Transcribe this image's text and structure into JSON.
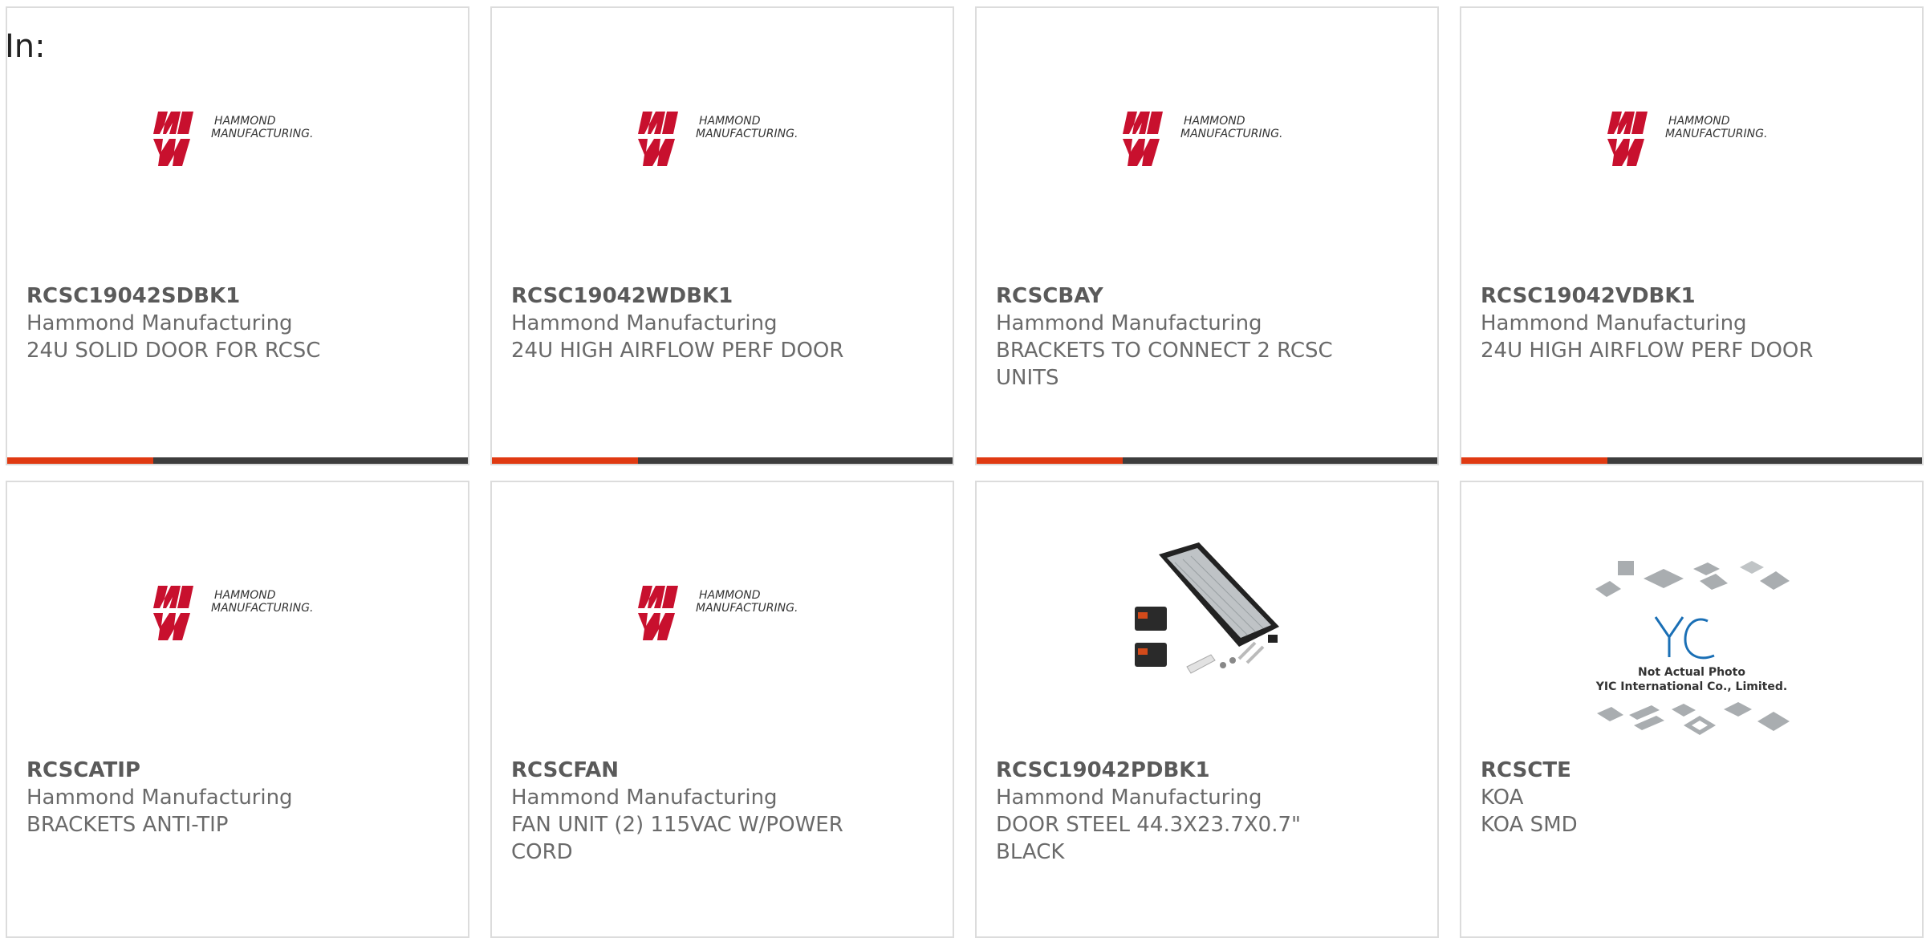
{
  "filter_label": "In:",
  "products": [
    {
      "part": "RCSC19042SDBK1",
      "manufacturer": "Hammond Manufacturing",
      "description": "24U SOLID DOOR FOR RCSC",
      "image": "hammond-logo"
    },
    {
      "part": "RCSC19042WDBK1",
      "manufacturer": "Hammond Manufacturing",
      "description": "24U HIGH AIRFLOW PERF DOOR",
      "image": "hammond-logo"
    },
    {
      "part": "RCSCBAY",
      "manufacturer": "Hammond Manufacturing",
      "description": "BRACKETS TO CONNECT 2 RCSC UNITS",
      "image": "hammond-logo"
    },
    {
      "part": "RCSC19042VDBK1",
      "manufacturer": "Hammond Manufacturing",
      "description": "24U HIGH AIRFLOW PERF DOOR",
      "image": "hammond-logo"
    },
    {
      "part": "RCSCATIP",
      "manufacturer": "Hammond Manufacturing",
      "description": "BRACKETS ANTI-TIP",
      "image": "hammond-logo"
    },
    {
      "part": "RCSCFAN",
      "manufacturer": "Hammond Manufacturing",
      "description": "FAN UNIT (2) 115VAC W/POWER CORD",
      "image": "hammond-logo"
    },
    {
      "part": "RCSC19042PDBK1",
      "manufacturer": "Hammond Manufacturing",
      "description": "DOOR STEEL 44.3X23.7X0.7\" BLACK",
      "image": "door-product-photo"
    },
    {
      "part": "RCSCTE",
      "manufacturer": "KOA",
      "description": "KOA SMD",
      "image": "not-actual-photo-placeholder"
    }
  ],
  "logo": {
    "line1": "HAMMOND",
    "line2": "MANUFACTURING."
  },
  "placeholder": {
    "brand": "YIC",
    "caption1": "Not Actual Photo",
    "caption2": "YIC International Co., Limited."
  },
  "colors": {
    "accent": "#e03a12",
    "bar": "#3d3d3d",
    "logo_red": "#c8102e"
  }
}
